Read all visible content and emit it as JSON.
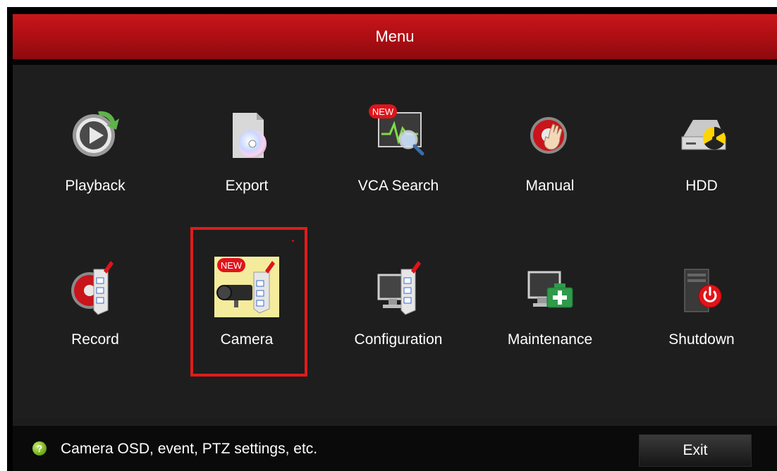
{
  "window": {
    "title": "Menu"
  },
  "menu": {
    "row1": [
      {
        "label": "Playback",
        "icon": "playback-icon"
      },
      {
        "label": "Export",
        "icon": "export-disc-icon"
      },
      {
        "label": "VCA Search",
        "icon": "vca-search-icon",
        "badge": "NEW"
      },
      {
        "label": "Manual",
        "icon": "manual-record-hand-icon"
      },
      {
        "label": "HDD",
        "icon": "hdd-icon"
      }
    ],
    "row2": [
      {
        "label": "Record",
        "icon": "record-schedule-icon"
      },
      {
        "label": "Camera",
        "icon": "camera-settings-icon",
        "badge": "NEW",
        "selected": true
      },
      {
        "label": "Configuration",
        "icon": "configuration-icon"
      },
      {
        "label": "Maintenance",
        "icon": "maintenance-icon"
      },
      {
        "label": "Shutdown",
        "icon": "shutdown-icon"
      }
    ]
  },
  "status": {
    "hint": "Camera OSD, event, PTZ settings, etc.",
    "hint_icon_glyph": "?",
    "exit_label": "Exit"
  },
  "colors": {
    "titlebar": "#b10f14",
    "accent_red": "#e11b1b",
    "background": "#1e1e1e",
    "selected_tile": "#f4ec9c"
  }
}
